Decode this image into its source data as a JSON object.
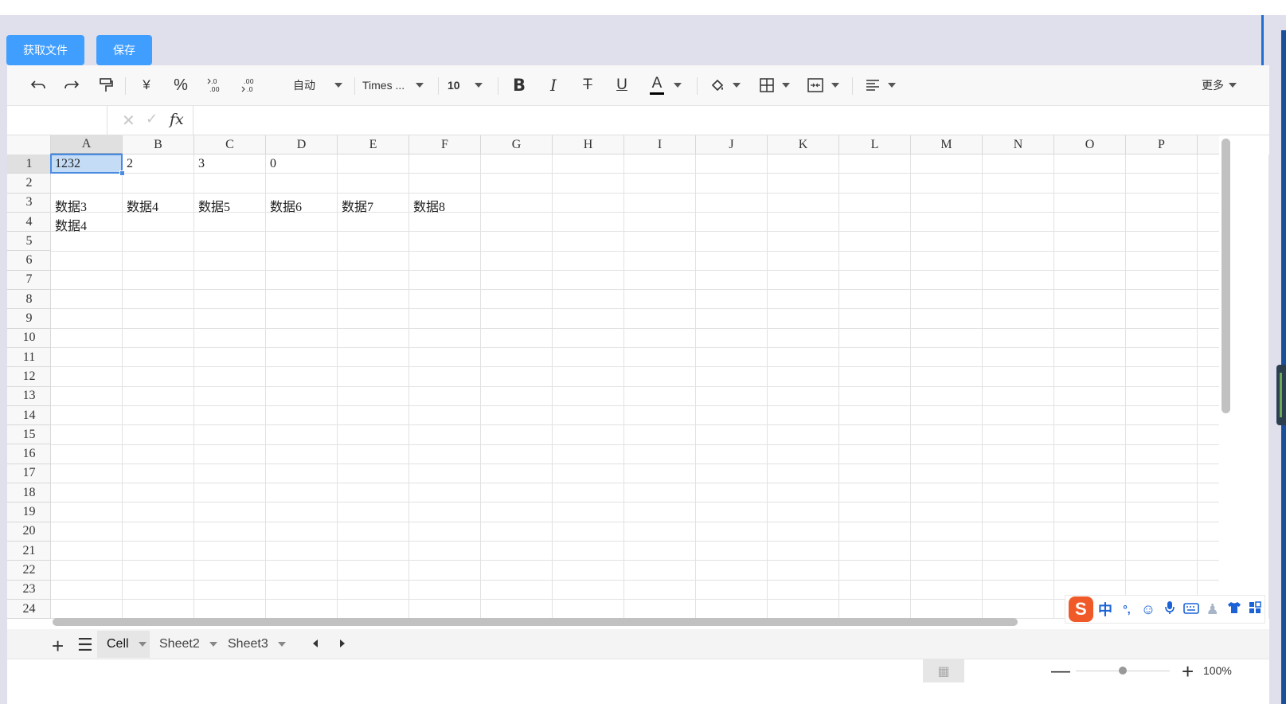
{
  "buttons": {
    "get_file": "获取文件",
    "save": "保存"
  },
  "toolbar": {
    "number_format": "自动",
    "font_family": "Times ...",
    "font_size": "10",
    "more": "更多",
    "currency_symbol": "¥",
    "percent_symbol": "%",
    "text_color": "#000000"
  },
  "formula_bar": {
    "namebox": "",
    "fx": "fx",
    "value": ""
  },
  "sheet": {
    "columns": [
      "A",
      "B",
      "C",
      "D",
      "E",
      "F",
      "G",
      "H",
      "I",
      "J",
      "K",
      "L",
      "M",
      "N",
      "O",
      "P"
    ],
    "rows": [
      "1",
      "2",
      "3",
      "4",
      "5",
      "6",
      "7",
      "8",
      "9",
      "10",
      "11",
      "12",
      "13",
      "14",
      "15",
      "16",
      "17",
      "18",
      "19",
      "20",
      "21",
      "22",
      "23",
      "24"
    ],
    "selected_cell": "A1",
    "cells": {
      "A1": "1232",
      "B1": "2",
      "C1": "3",
      "D1": "0",
      "A3": "数据3",
      "B3": "数据4",
      "C3": "数据5",
      "D3": "数据6",
      "E3": "数据7",
      "F3": "数据8",
      "A4": "数据4"
    }
  },
  "sheet_tabs": [
    "Cell",
    "Sheet2",
    "Sheet3"
  ],
  "active_tab": "Cell",
  "zoom": "100%",
  "ime": {
    "mode": "中",
    "punct": "°,",
    "logo": "S"
  }
}
